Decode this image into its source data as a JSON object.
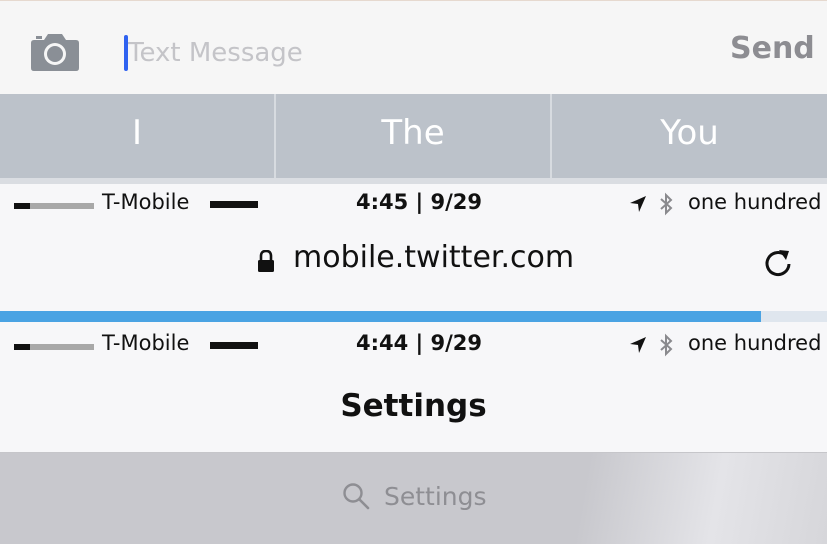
{
  "compose": {
    "placeholder": "Text Message",
    "send_label": "Send"
  },
  "predictive": {
    "suggestions": [
      "I",
      "The",
      "You"
    ]
  },
  "status_top": {
    "carrier": "T-Mobile",
    "time": "4:45 | 9/29",
    "battery": "one hundred"
  },
  "safari": {
    "url": "mobile.twitter.com",
    "progress": 0.92
  },
  "status_bottom": {
    "carrier": "T-Mobile",
    "time": "4:44 | 9/29",
    "battery": "one hundred"
  },
  "settings": {
    "title": "Settings",
    "search_placeholder": "Settings"
  },
  "icons": {
    "camera": "camera-icon",
    "location": "location-arrow-icon",
    "bluetooth": "bluetooth-icon",
    "lock": "lock-icon",
    "reload": "reload-icon",
    "search": "search-icon"
  },
  "colors": {
    "caret": "#2f62f0",
    "progress": "#4aa3e3",
    "predictive_bg": "#bcc2ca"
  }
}
